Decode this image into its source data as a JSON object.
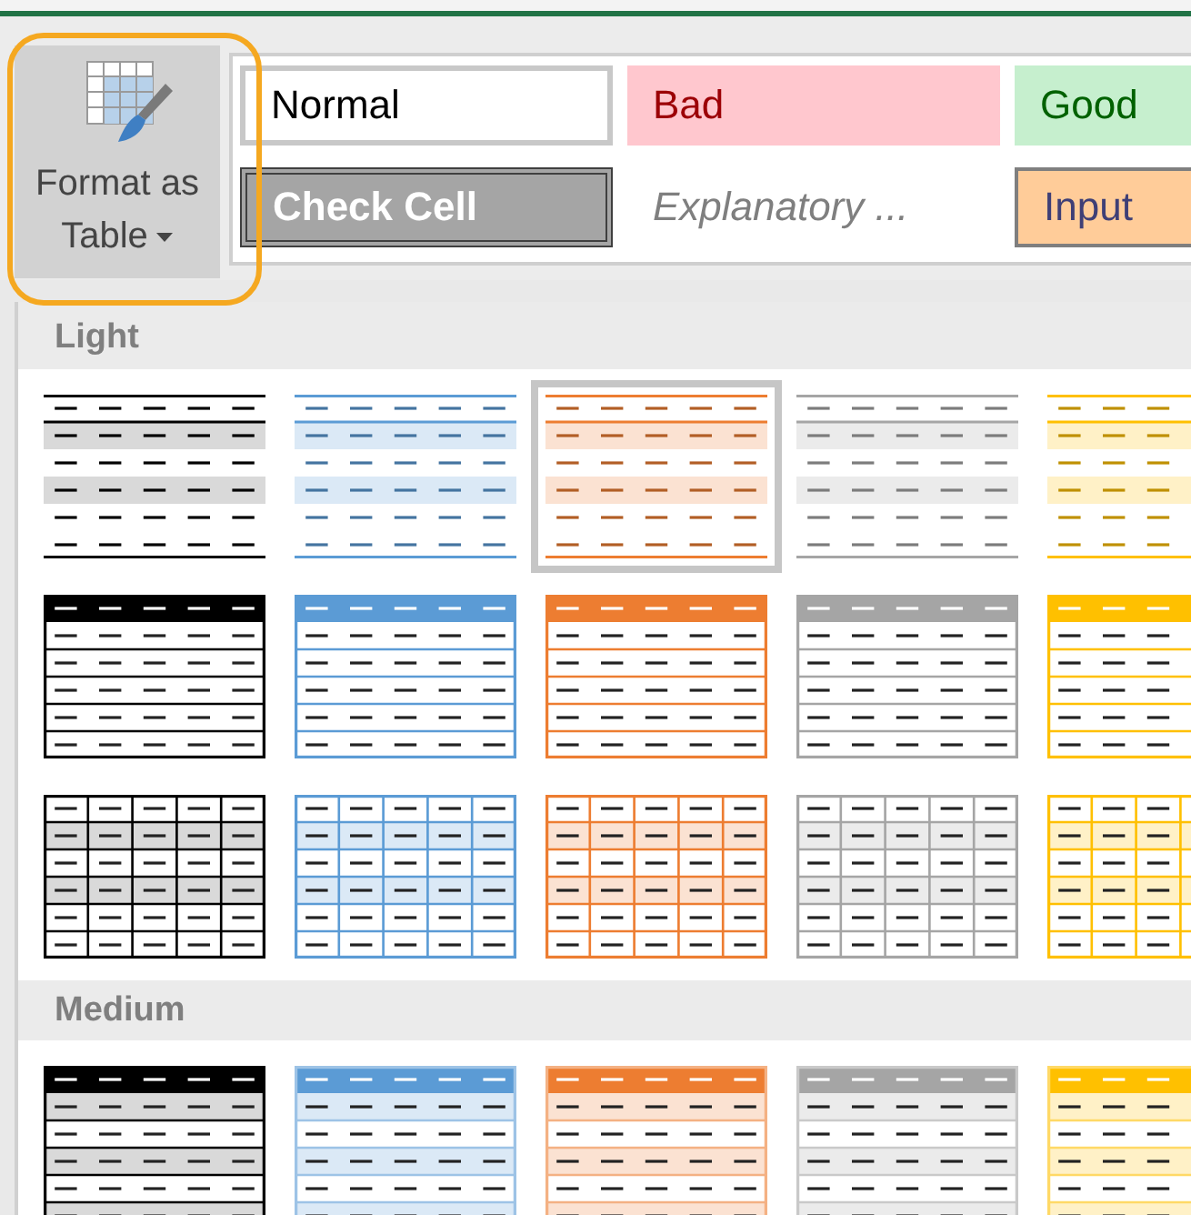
{
  "format_button": {
    "label": "Format as Table"
  },
  "cell_styles": [
    {
      "kind": "normal",
      "label": "Normal"
    },
    {
      "kind": "bad",
      "label": "Bad"
    },
    {
      "kind": "good",
      "label": "Good"
    },
    {
      "kind": "check",
      "label": "Check Cell"
    },
    {
      "kind": "explanatory",
      "label": "Explanatory ..."
    },
    {
      "kind": "input",
      "label": "Input"
    }
  ],
  "sections": [
    {
      "title": "Light",
      "rows": [
        {
          "kind": "banded",
          "items": [
            {
              "color": "#000000",
              "selected": false
            },
            {
              "color": "#5b9bd5",
              "selected": false
            },
            {
              "color": "#ed7d31",
              "selected": true
            },
            {
              "color": "#a5a5a5",
              "selected": false
            },
            {
              "color": "#ffc000",
              "selected": false
            }
          ]
        },
        {
          "kind": "header",
          "items": [
            {
              "color": "#000000",
              "selected": false
            },
            {
              "color": "#5b9bd5",
              "selected": false
            },
            {
              "color": "#ed7d31",
              "selected": false
            },
            {
              "color": "#a5a5a5",
              "selected": false
            },
            {
              "color": "#ffc000",
              "selected": false
            }
          ]
        },
        {
          "kind": "grid",
          "items": [
            {
              "color": "#000000",
              "selected": false
            },
            {
              "color": "#5b9bd5",
              "selected": false
            },
            {
              "color": "#ed7d31",
              "selected": false
            },
            {
              "color": "#a5a5a5",
              "selected": false
            },
            {
              "color": "#ffc000",
              "selected": false
            }
          ]
        }
      ]
    },
    {
      "title": "Medium",
      "rows": [
        {
          "kind": "medium",
          "items": [
            {
              "color": "#000000",
              "selected": false
            },
            {
              "color": "#5b9bd5",
              "selected": false
            },
            {
              "color": "#ed7d31",
              "selected": false
            },
            {
              "color": "#a5a5a5",
              "selected": false
            },
            {
              "color": "#ffc000",
              "selected": false
            }
          ]
        }
      ]
    }
  ]
}
